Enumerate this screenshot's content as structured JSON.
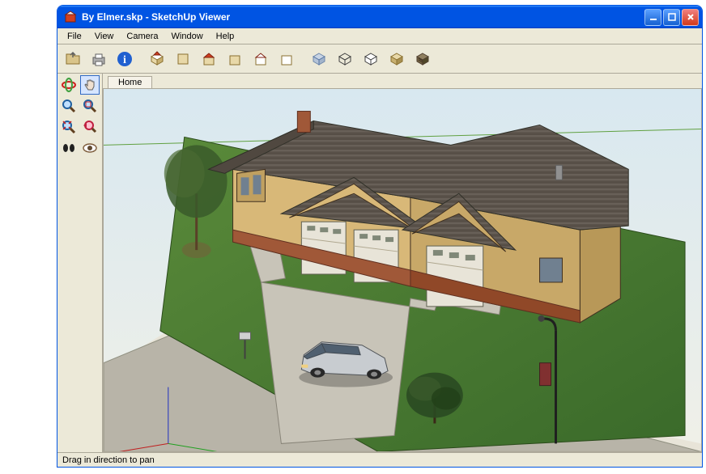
{
  "window": {
    "title": "By Elmer.skp - SketchUp Viewer"
  },
  "menu": {
    "items": [
      "File",
      "View",
      "Camera",
      "Window",
      "Help"
    ]
  },
  "toolbar": {
    "tools": [
      {
        "name": "open-file-icon"
      },
      {
        "name": "print-icon"
      },
      {
        "name": "info-icon"
      },
      {
        "name": "iso-view-icon"
      },
      {
        "name": "top-view-icon"
      },
      {
        "name": "front-view-icon"
      },
      {
        "name": "right-view-icon"
      },
      {
        "name": "back-view-icon"
      },
      {
        "name": "left-view-icon"
      },
      {
        "name": "xray-icon"
      },
      {
        "name": "wireframe-icon"
      },
      {
        "name": "hidden-line-icon"
      },
      {
        "name": "shaded-icon"
      },
      {
        "name": "shaded-textures-icon"
      }
    ]
  },
  "side": {
    "tools": [
      {
        "name": "orbit-icon"
      },
      {
        "name": "pan-icon",
        "active": true
      },
      {
        "name": "zoom-icon"
      },
      {
        "name": "zoom-window-icon"
      },
      {
        "name": "zoom-extents-icon"
      },
      {
        "name": "previous-view-icon"
      },
      {
        "name": "walk-icon"
      },
      {
        "name": "look-around-icon"
      }
    ]
  },
  "scene": {
    "tab": "Home"
  },
  "status": {
    "text": "Drag in direction to pan"
  }
}
